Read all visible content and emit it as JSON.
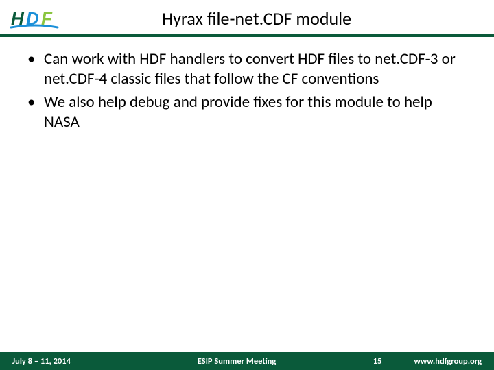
{
  "header": {
    "title": "Hyrax file-net.CDF module"
  },
  "bullets": [
    "Can work with HDF handlers to convert HDF files to net.CDF-3 or net.CDF-4 classic files that follow the CF conventions",
    "We also help debug and provide fixes for this module to help NASA"
  ],
  "footer": {
    "date": "July 8 – 11, 2014",
    "middle": "ESIP Summer Meeting",
    "page": "15",
    "url": "www.hdfgroup.org"
  }
}
